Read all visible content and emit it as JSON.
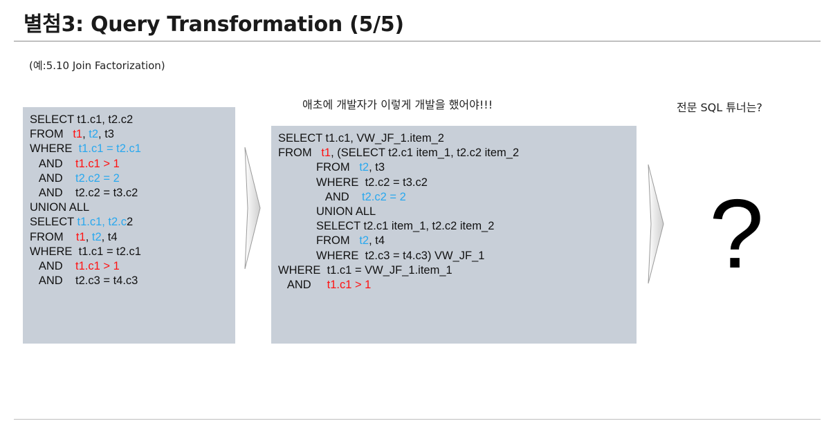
{
  "title": "별첨3: Query Transformation (5/5)",
  "example_note": "(예:5.10 Join Factorization)",
  "caption_mid": "애초에 개발자가 이렇게 개발을 했어야!!!",
  "caption_right": "전문 SQL 튜너는?",
  "question_mark": "?",
  "left_sql": [
    [
      {
        "t": "SELECT t1.c1, t2.c2"
      }
    ],
    [
      {
        "t": "FROM   "
      },
      {
        "t": "t1",
        "c": "red"
      },
      {
        "t": ", "
      },
      {
        "t": "t2",
        "c": "blue"
      },
      {
        "t": ", t3"
      }
    ],
    [
      {
        "t": "WHERE  "
      },
      {
        "t": "t1.c1 = t2.c1",
        "c": "blue"
      }
    ],
    [
      {
        "t": "   AND    "
      },
      {
        "t": "t1.c1 > 1",
        "c": "red"
      }
    ],
    [
      {
        "t": "   AND    "
      },
      {
        "t": "t2.c2 = 2",
        "c": "blue"
      }
    ],
    [
      {
        "t": "   AND    t2.c2 = t3.c2"
      }
    ],
    [
      {
        "t": "UNION ALL"
      }
    ],
    [
      {
        "t": "SELECT "
      },
      {
        "t": "t1.c1, t2.c",
        "c": "blue"
      },
      {
        "t": "2"
      }
    ],
    [
      {
        "t": "FROM    "
      },
      {
        "t": "t1",
        "c": "red"
      },
      {
        "t": ", "
      },
      {
        "t": "t2",
        "c": "blue"
      },
      {
        "t": ", t4"
      }
    ],
    [
      {
        "t": "WHERE  t1.c1 = t2.c1"
      }
    ],
    [
      {
        "t": "   AND    "
      },
      {
        "t": "t1.c1 > 1",
        "c": "red"
      }
    ],
    [
      {
        "t": "   AND    t2.c3 = t4.c3"
      }
    ]
  ],
  "mid_sql": [
    [
      {
        "t": "SELECT t1.c1, VW_JF_1.item_2"
      }
    ],
    [
      {
        "t": "FROM   "
      },
      {
        "t": "t1",
        "c": "red"
      },
      {
        "t": ", (SELECT t2.c1 item_1, t2.c2 item_2"
      }
    ],
    [
      {
        "t": "            FROM   "
      },
      {
        "t": "t2",
        "c": "blue"
      },
      {
        "t": ", t3"
      }
    ],
    [
      {
        "t": "            WHERE  t2.c2 = t3.c2"
      }
    ],
    [
      {
        "t": "               AND    "
      },
      {
        "t": "t2.c2 = 2",
        "c": "blue"
      }
    ],
    [
      {
        "t": "            UNION ALL"
      }
    ],
    [
      {
        "t": "            SELECT t2.c1 item_1, t2.c2 item_2"
      }
    ],
    [
      {
        "t": "            FROM   "
      },
      {
        "t": "t2",
        "c": "blue"
      },
      {
        "t": ", t4"
      }
    ],
    [
      {
        "t": "            WHERE  t2.c3 = t4.c3) VW_JF_1"
      }
    ],
    [
      {
        "t": "WHERE  t1.c1 = VW_JF_1.item_1"
      }
    ],
    [
      {
        "t": "   AND     "
      },
      {
        "t": "t1.c1 > 1",
        "c": "red"
      }
    ]
  ],
  "colors": {
    "panel_bg": "#c8cfd8",
    "highlight_red": "#ff1111",
    "highlight_blue": "#2aa8ee",
    "arrow_fill": "#e6e6e6",
    "arrow_edge": "#9a9a9a"
  },
  "icons": [
    "chevron-right-icon",
    "chevron-right-icon"
  ]
}
